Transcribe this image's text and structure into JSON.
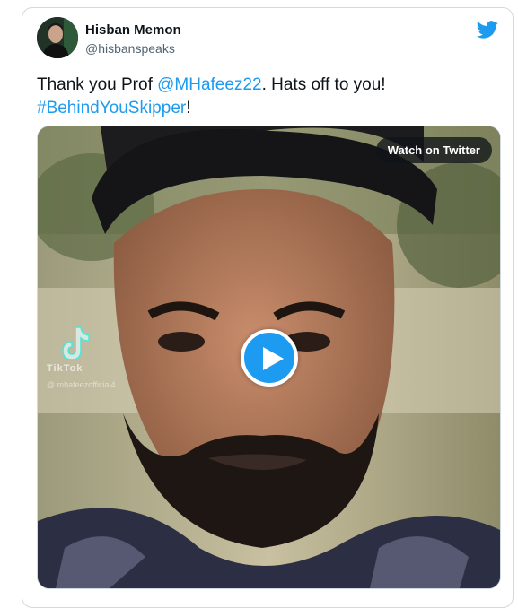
{
  "tweet": {
    "display_name": "Hisban Memon",
    "handle": "@hisbanspeaks",
    "text_prefix": "Thank you Prof ",
    "mention": "@MHafeez22",
    "text_middle": ". Hats off to you!",
    "hashtag": "#BehindYouSkipper",
    "text_suffix": "!"
  },
  "media": {
    "watch_label": "Watch on Twitter",
    "tiktok_label": "TikTok",
    "tiktok_user": "@ mhafeezofficial4",
    "play_icon": "play-icon"
  },
  "colors": {
    "accent": "#1d9bf0",
    "text": "#0f1419",
    "muted": "#536471",
    "border": "#cfd9de"
  }
}
